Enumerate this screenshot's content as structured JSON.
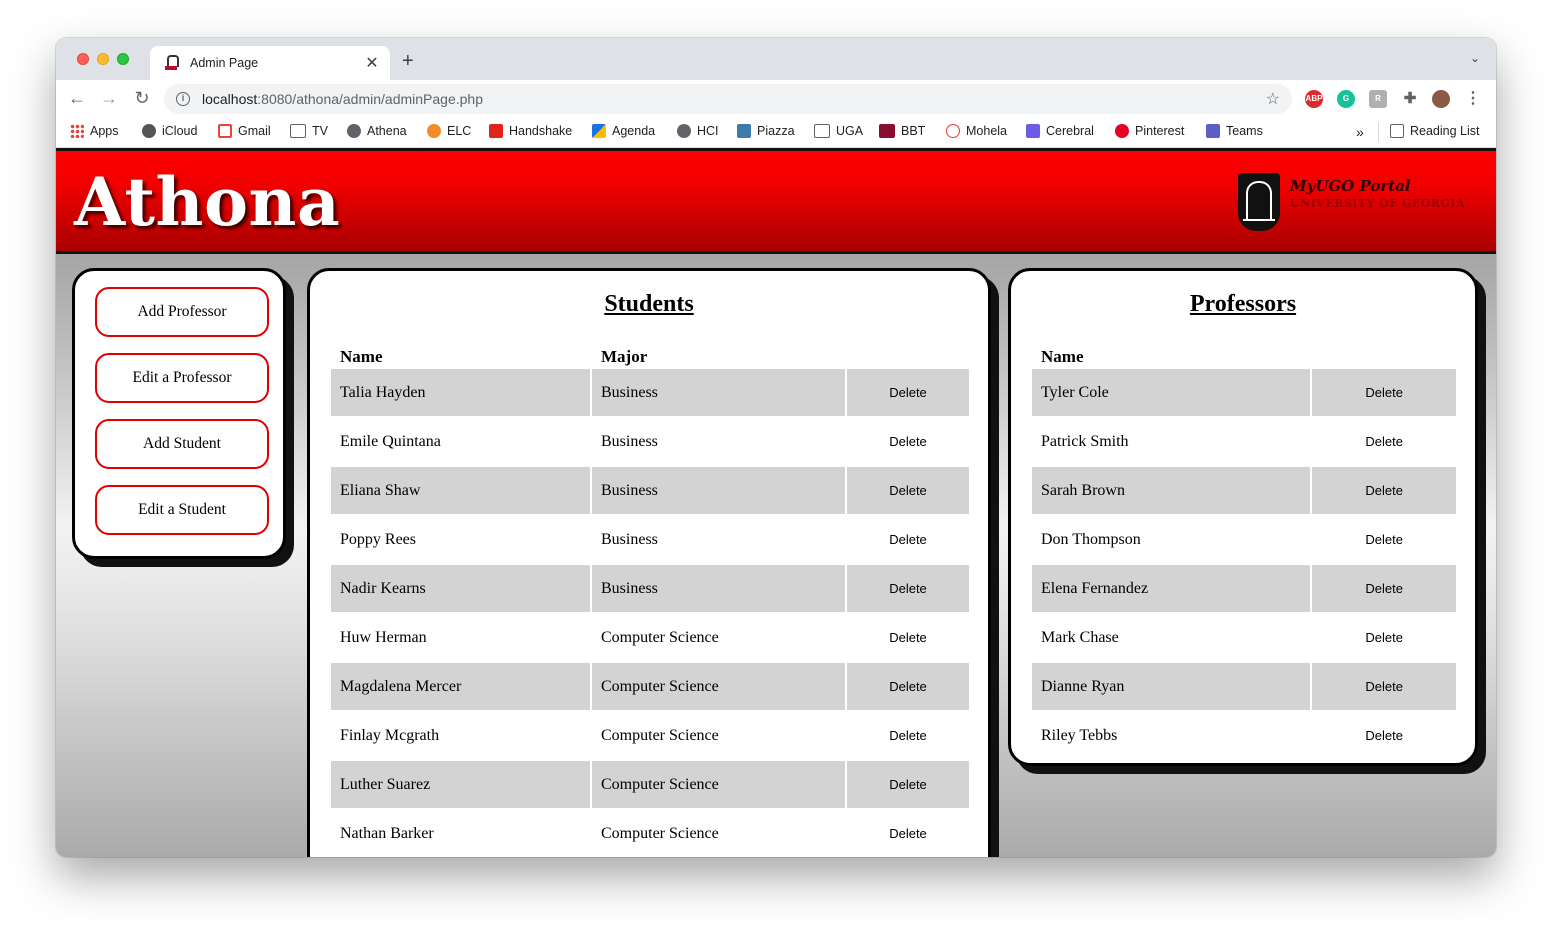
{
  "browser": {
    "tab_title": "Admin Page",
    "url_host": "localhost",
    "url_rest": ":8080/athona/admin/adminPage.php",
    "bookmarks": [
      "Apps",
      "iCloud",
      "Gmail",
      "TV",
      "Athena",
      "ELC",
      "Handshake",
      "Agenda",
      "HCI",
      "Piazza",
      "UGA",
      "BBT",
      "Mohela",
      "Cerebral",
      "Pinterest",
      "Teams"
    ],
    "more": "»",
    "reading_list": "Reading List",
    "ext_abp": "ABP"
  },
  "header": {
    "brand": "Athona",
    "logo_title": "MyUGO Portal",
    "logo_subtitle": "UNIVERSITY OF GEORGIA"
  },
  "menu": {
    "buttons": [
      "Add Professor",
      "Edit a Professor",
      "Add Student",
      "Edit a Student"
    ]
  },
  "students": {
    "title": "Students",
    "col_name": "Name",
    "col_major": "Major",
    "delete_label": "Delete",
    "rows": [
      {
        "name": "Talia Hayden",
        "major": "Business"
      },
      {
        "name": "Emile Quintana",
        "major": "Business"
      },
      {
        "name": "Eliana Shaw",
        "major": "Business"
      },
      {
        "name": "Poppy Rees",
        "major": "Business"
      },
      {
        "name": "Nadir Kearns",
        "major": "Business"
      },
      {
        "name": "Huw Herman",
        "major": "Computer Science"
      },
      {
        "name": "Magdalena Mercer",
        "major": "Computer Science"
      },
      {
        "name": "Finlay Mcgrath",
        "major": "Computer Science"
      },
      {
        "name": "Luther Suarez",
        "major": "Computer Science"
      },
      {
        "name": "Nathan Barker",
        "major": "Computer Science"
      }
    ]
  },
  "professors": {
    "title": "Professors",
    "col_name": "Name",
    "delete_label": "Delete",
    "rows": [
      {
        "name": "Tyler Cole"
      },
      {
        "name": "Patrick Smith"
      },
      {
        "name": "Sarah Brown"
      },
      {
        "name": "Don Thompson"
      },
      {
        "name": "Elena Fernandez"
      },
      {
        "name": "Mark Chase"
      },
      {
        "name": "Dianne Ryan"
      },
      {
        "name": "Riley Tebbs"
      }
    ]
  },
  "colors": {
    "banner_red": "#ff0000",
    "button_border": "#e00000",
    "row_shade": "#d3d3d3"
  }
}
